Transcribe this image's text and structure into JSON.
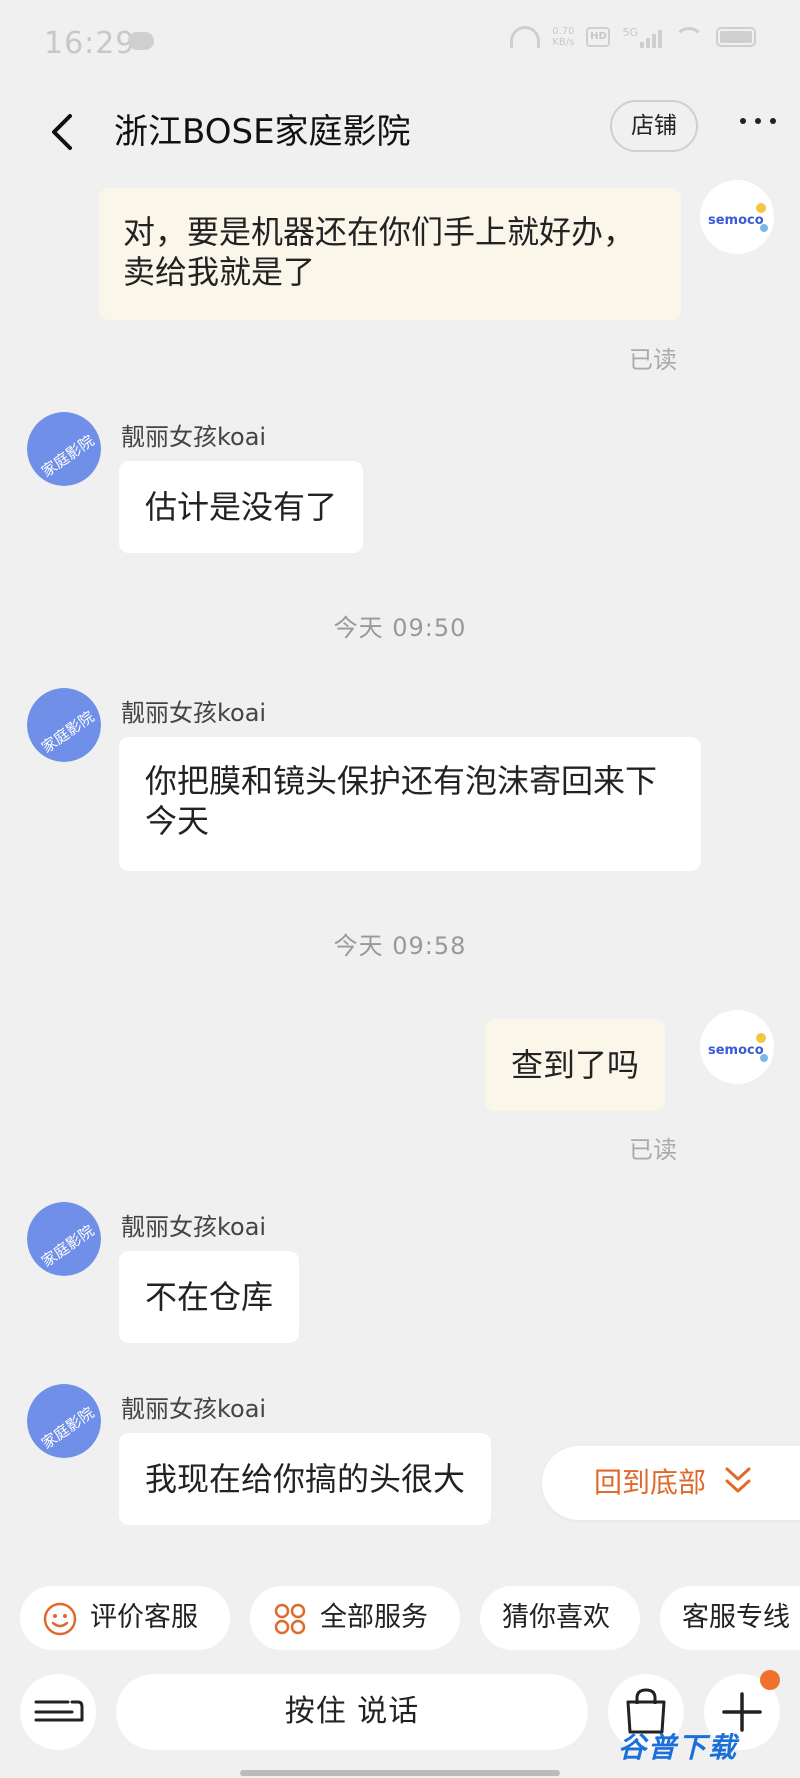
{
  "status_bar": {
    "time": "16:29",
    "net_speed_value": "0.70",
    "net_speed_unit": "KB/s",
    "hd_label": "HD",
    "network": "5G"
  },
  "header": {
    "title": "浙江BOSE家庭影院",
    "shop_label": "店铺"
  },
  "avatars": {
    "shop_text": "家庭影院",
    "user_text": "semoco"
  },
  "messages": [
    {
      "text": "对，要是机器还在你们手上就好办，卖给我就是了",
      "read": "已读"
    },
    {
      "sender": "靓丽女孩koai",
      "text": "估计是没有了"
    },
    {
      "timestamp": "今天  09:50"
    },
    {
      "sender": "靓丽女孩koai",
      "text": "你把膜和镜头保护还有泡沫寄回来下今天"
    },
    {
      "timestamp": "今天  09:58"
    },
    {
      "text": "查到了吗",
      "read": "已读"
    },
    {
      "sender": "靓丽女孩koai",
      "text": "不在仓库"
    },
    {
      "sender": "靓丽女孩koai",
      "text": "我现在给你搞的头很大"
    }
  ],
  "scroll_bottom_label": "回到底部",
  "quick_actions": [
    "评价客服",
    "全部服务",
    "猜你喜欢",
    "客服专线"
  ],
  "input": {
    "voice_label": "按住 说话"
  },
  "watermark": "谷普下载",
  "colors": {
    "accent": "#e06a2c",
    "my_bubble": "#fbf6ea",
    "background": "#f0f0f0"
  }
}
